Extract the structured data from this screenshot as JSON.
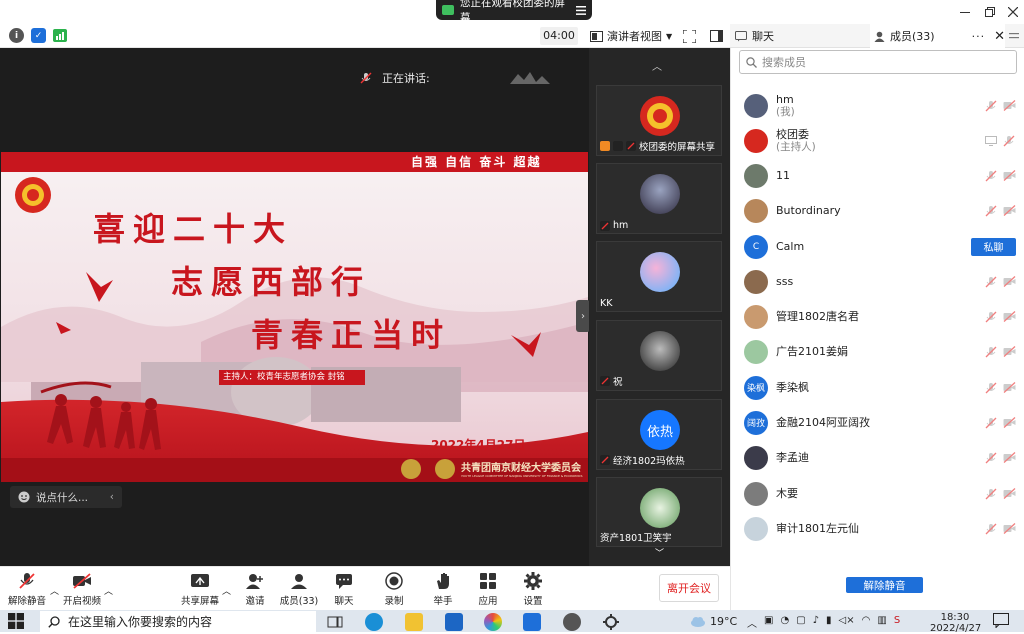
{
  "window": {
    "share_notice": "您正在观看校团委的屏幕",
    "controls": [
      "minimize",
      "restore",
      "close"
    ]
  },
  "toolbar": {
    "timer": "04:00",
    "view_label": "演讲者视图"
  },
  "stage": {
    "speaking_label": "正在讲话:",
    "say_placeholder": "说点什么...",
    "slide": {
      "slogan": "自强 自信 奋斗 超越",
      "line1": "喜迎二十大",
      "line2": "志愿西部行",
      "line3": "青春正当时",
      "host": "主持人：校青年志愿者协会 封铭",
      "date": "2022年4月27日",
      "org": "共青团南京财经大学委员会",
      "org_en": "YOUTH LEAGUE COMMITTEE OF NANJING UNIVERSITY OF FINANCE & ECONOMICS"
    }
  },
  "thumbnails": [
    {
      "label": "校团委的屏幕共享",
      "avatar": "league-emblem"
    },
    {
      "label": "hm",
      "avatar": "photo-dark"
    },
    {
      "label": "KK",
      "avatar": "cartoon-pony"
    },
    {
      "label": "祝",
      "avatar": "photo-bw"
    },
    {
      "label": "经济1802玛依热",
      "avatar": "依热",
      "avatar_color": "#1677ff"
    },
    {
      "label": "资产1801卫笑宇",
      "avatar": "photo-green"
    }
  ],
  "panel": {
    "tab_chat": "聊天",
    "tab_members": "成员(33)",
    "search_placeholder": "搜索成员",
    "private_chat": "私聊",
    "unmute_all": "解除静音",
    "members": [
      {
        "name": "hm",
        "sub": "(我)",
        "avatar": "photo-dark",
        "color": "#56607a"
      },
      {
        "name": "校团委",
        "sub": "(主持人)",
        "avatar": "league-emblem",
        "color": "#d6281f"
      },
      {
        "name": "11",
        "sub": "",
        "avatar": "photo-gray",
        "color": "#6d7a6b"
      },
      {
        "name": "Butordinary",
        "sub": "",
        "avatar": "photo-tan",
        "color": "#b7875b"
      },
      {
        "name": "Calm",
        "sub": "",
        "avatar": "C",
        "color": "#1e6fd9"
      },
      {
        "name": "sss",
        "sub": "",
        "avatar": "photo-dog",
        "color": "#8b6a4e"
      },
      {
        "name": "管理1802唐名君",
        "sub": "",
        "avatar": "photo-girl",
        "color": "#c99a6f"
      },
      {
        "name": "广告2101姜娟",
        "sub": "",
        "avatar": "photo-sky",
        "color": "#9cc8a0"
      },
      {
        "name": "季染枫",
        "sub": "",
        "avatar": "染枫",
        "color": "#1e6fd9"
      },
      {
        "name": "金融2104阿亚阔孜",
        "sub": "",
        "avatar": "阔孜",
        "color": "#1e6fd9"
      },
      {
        "name": "李孟迪",
        "sub": "",
        "avatar": "photo-dark2",
        "color": "#3b3b4a"
      },
      {
        "name": "木要",
        "sub": "",
        "avatar": "photo-gray2",
        "color": "#7c7c7c"
      },
      {
        "name": "审计1801左元仙",
        "sub": "",
        "avatar": "photo-light",
        "color": "#c7d3dc"
      }
    ]
  },
  "bottombar": {
    "unmute": "解除静音",
    "video": "开启视频",
    "share": "共享屏幕",
    "invite": "邀请",
    "members": "成员(33)",
    "chat": "聊天",
    "record": "录制",
    "raise_hand": "举手",
    "apps": "应用",
    "settings": "设置",
    "leave": "离开会议"
  },
  "taskbar": {
    "search_placeholder": "在这里输入你要搜索的内容",
    "temperature": "19°C",
    "time": "18:30",
    "date": "2022/4/27"
  }
}
